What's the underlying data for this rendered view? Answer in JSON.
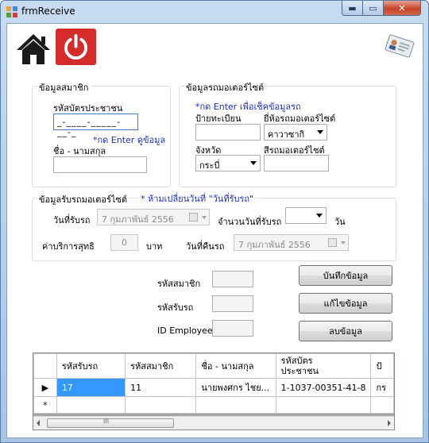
{
  "window": {
    "title": "frmReceive",
    "min": "▬",
    "max": "▭",
    "close": "✕"
  },
  "toolbar": {
    "home_icon": "home-icon",
    "power_icon": "power-icon",
    "card_icon": "id-card-icon"
  },
  "member_group": {
    "legend": "ข้อมูลสมาชิก",
    "id_card_label": "รหัสบัตรประชาชน",
    "id_card_value": "_-____-_____-__-_",
    "hint": "*กด Enter ดูข้อมูล",
    "name_label": "ชื่อ - นามสกุล",
    "name_value": ""
  },
  "moto_group": {
    "legend": "ข้อมูลรถมอเตอร์ไซต์",
    "hint": "*กด Enter เพื่อเช็คข้อมูลรถ",
    "plate_label": "ป้ายทะเบียน",
    "brand_label": "ยี่ห้อรถมอเตอร์ไซต์",
    "brand_value": "คาวาซากิ",
    "province_label": "จังหวัด",
    "province_value": "กระบี่",
    "color_label": "สีรถมอเตอร์ไซต์"
  },
  "receive_group": {
    "legend": "ข้อมูลรับรถมอเตอร์ไซต์",
    "hint": "* ห้ามเปลี่ยนวันที่ \"วันที่รับรถ\"",
    "receive_date_label": "วันที่รับรถ",
    "receive_date_value": "7  กุมภาพันธ์   2556",
    "days_label": "จำนวนวันที่รับรถ",
    "days_unit": "วัน",
    "service_label": "ค่าบริการสุทธิ",
    "service_value": "0",
    "baht": "บาท",
    "return_date_label": "วันที่คืนรถ",
    "return_date_value": "7  กุมภาพันธ์   2556"
  },
  "ids": {
    "member_label": "รหัสสมาชิก",
    "receive_label": "รหัสรับรถ",
    "employee_label": "ID Employee"
  },
  "buttons": {
    "save": "บันทึกข้อมูล",
    "edit": "แก้ไขข้อมูล",
    "delete": "ลบข้อมูล"
  },
  "grid": {
    "headers": [
      "รหัสรับรถ",
      "รหัสสมาชิก",
      "ชื่อ - นามสกุล",
      "รหัสบัตร\nประชาชน",
      "ป้"
    ],
    "rows": [
      {
        "marker": "▶",
        "cells": [
          "17",
          "11",
          "นายพงศกร  ไชย...",
          "1-1037-00351-41-8",
          "กร"
        ]
      },
      {
        "marker": "*",
        "cells": [
          "",
          "",
          "",
          "",
          ""
        ]
      }
    ],
    "scroll_mark": "III"
  }
}
